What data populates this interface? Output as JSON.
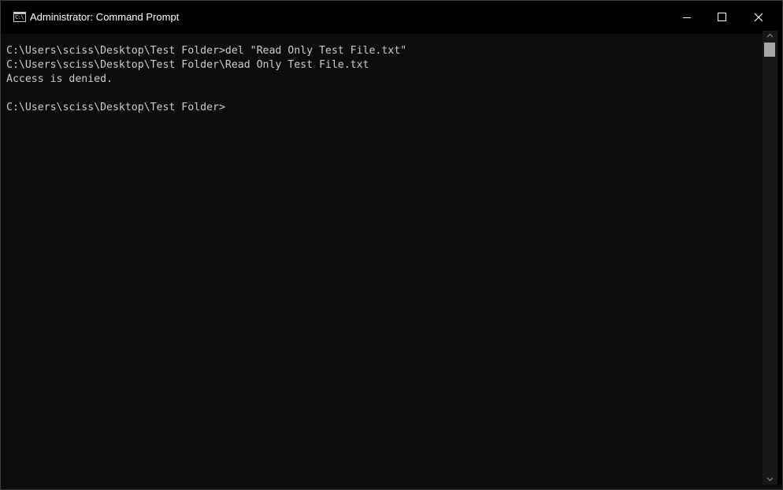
{
  "window": {
    "title": "Administrator: Command Prompt",
    "icon": "command-prompt-icon",
    "icon_glyph": "C:\\"
  },
  "controls": {
    "minimize_icon": "minimize-icon",
    "maximize_icon": "maximize-icon",
    "close_icon": "close-icon"
  },
  "console": {
    "lines": [
      "C:\\Users\\sciss\\Desktop\\Test Folder>del \"Read Only Test File.txt\"",
      "C:\\Users\\sciss\\Desktop\\Test Folder\\Read Only Test File.txt",
      "Access is denied.",
      "",
      "C:\\Users\\sciss\\Desktop\\Test Folder>"
    ]
  },
  "scrollbar": {
    "up_icon": "scroll-up-arrow-icon",
    "down_icon": "scroll-down-arrow-icon"
  },
  "colors": {
    "titlebar_bg": "#000000",
    "console_bg": "#0c0c0c",
    "console_text": "#cccccc",
    "title_text": "#ffffff"
  }
}
